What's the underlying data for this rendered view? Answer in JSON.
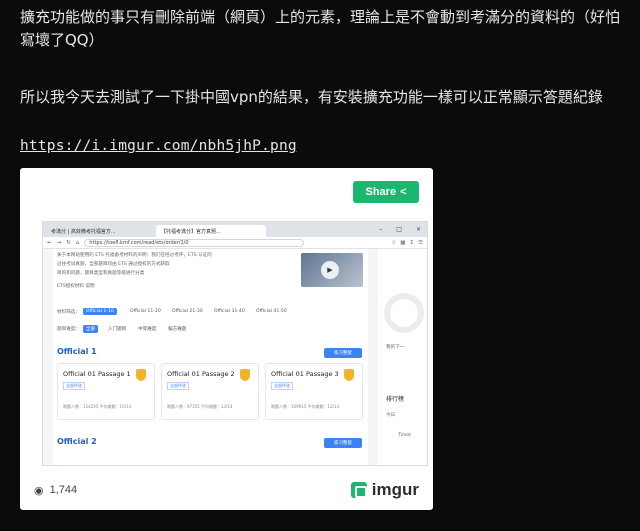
{
  "post": {
    "paragraph1": "擴充功能做的事只有刪除前端（網頁）上的元素，理論上是不會動到考滿分的資料的（好怕寫壞了QQ）",
    "paragraph2": "所以我今天去測試了一下掛中國vpn的結果，有安裝擴充功能一樣可以正常顯示答題紀錄",
    "link": "https://i.imgur.com/nbh5jhP.png"
  },
  "embed": {
    "share_label": "Share",
    "views": "1,744",
    "brand": "imgur",
    "accent_color": "#1bb76e"
  },
  "screenshot": {
    "tabs": [
      "考滿分 | 高效備考托福官方...",
      "【托福考滿分】官方真題..."
    ],
    "url": "https://toefl.kmf.com/read/ets/order/1/0",
    "intro_line1": "关于本网站使用的 ETS 托福备考材料的声明：我们在经过考评，ETS 认证的",
    "intro_line2": "过往考试真题，全部题目均由 ETS 通过授权的方式获取",
    "intro_line3": "目的和问题，题目类型和真题等级进行分类",
    "ets_note": "ETS授权材料 说明",
    "filter_label": "材料筛选：",
    "filters": [
      "Official 1-10",
      "Official 11-20",
      "Official 21-30",
      "Official 31-40",
      "Official 41-50"
    ],
    "diff_label": "题目难度：",
    "diffs": [
      "全部",
      "入门题目",
      "中等难度",
      "偏方难题"
    ],
    "section1": "Official 1",
    "section2": "Official 2",
    "practice_btn": "练习整套",
    "cards": [
      {
        "title": "Official 01 Passage 1",
        "tag": "全部作答",
        "meta": "做题人数：154295   平均做题：10/14"
      },
      {
        "title": "Official 01 Passage 2",
        "tag": "全部作答",
        "meta": "做题人数：97355   平均做题：13/14"
      },
      {
        "title": "Official 01 Passage 3",
        "tag": "全部作答",
        "meta": "做题人数：109915   平均做题：12/14"
      }
    ],
    "side_text1": "我的下一",
    "side_rank": "排行榜",
    "side_today": "今日",
    "side_user": "Timot"
  }
}
